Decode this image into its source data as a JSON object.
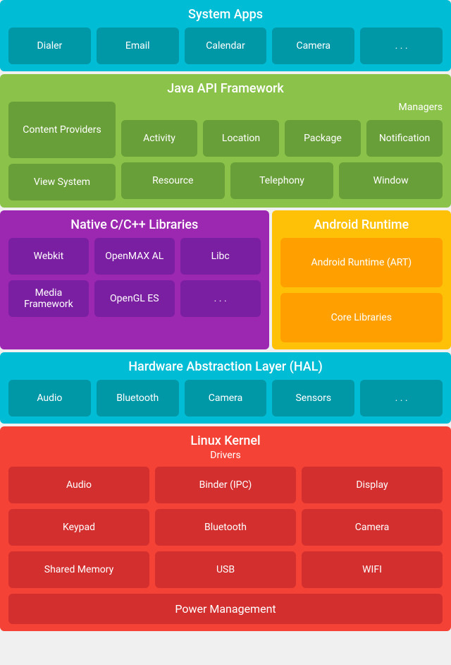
{
  "systemApps": {
    "title": "System Apps",
    "items": [
      "Dialer",
      "Email",
      "Calendar",
      "Camera",
      ". . ."
    ]
  },
  "javaApi": {
    "title": "Java API Framework",
    "managersLabel": "Managers",
    "left": [
      "Content Providers",
      "View System"
    ],
    "managers": [
      "Activity",
      "Location",
      "Package",
      "Notification"
    ],
    "resources": [
      "Resource",
      "Telephony",
      "Window"
    ]
  },
  "nativeLibs": {
    "title": "Native C/C++ Libraries",
    "items": [
      "Webkit",
      "OpenMAX AL",
      "Libc",
      "Media Framework",
      "OpenGL ES",
      ". . ."
    ]
  },
  "androidRuntime": {
    "title": "Android Runtime",
    "items": [
      "Android Runtime (ART)",
      "Core Libraries"
    ]
  },
  "hal": {
    "title": "Hardware Abstraction Layer (HAL)",
    "items": [
      "Audio",
      "Bluetooth",
      "Camera",
      "Sensors",
      ". . ."
    ]
  },
  "linuxKernel": {
    "title": "Linux Kernel",
    "driversLabel": "Drivers",
    "drivers": [
      "Audio",
      "Binder (IPC)",
      "Display",
      "Keypad",
      "Bluetooth",
      "Camera",
      "Shared Memory",
      "USB",
      "WIFI"
    ],
    "powerManagement": "Power Management"
  }
}
